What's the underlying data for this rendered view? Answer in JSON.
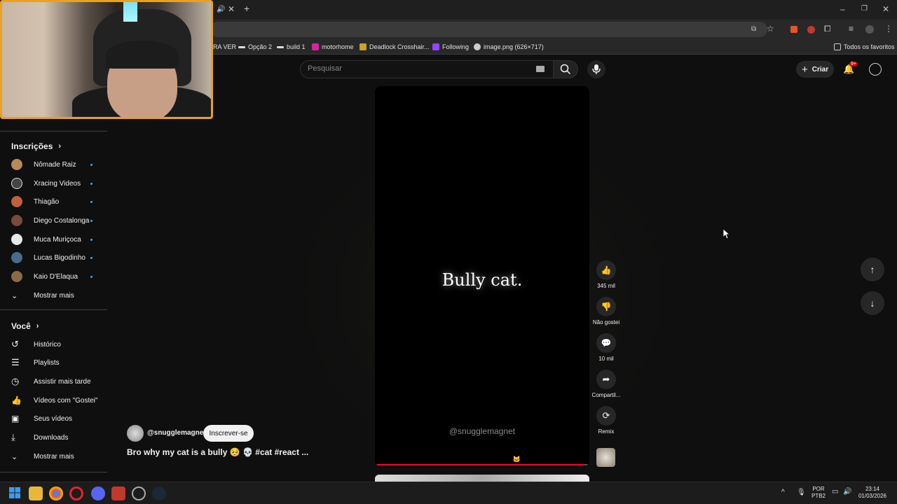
{
  "browser": {
    "new_tab_label": "+",
    "bookmarks": [
      {
        "label": "RA VER",
        "color": "#333333"
      },
      {
        "label": "Opção 2",
        "color": "#dddddd"
      },
      {
        "label": "build 1",
        "color": "#dddddd"
      },
      {
        "label": "motorhome",
        "color": "#d6249f"
      },
      {
        "label": "Deadlock Crosshair...",
        "color": "#c9a227"
      },
      {
        "label": "Following",
        "color": "#9146ff"
      },
      {
        "label": "image.png (626×717)",
        "color": "#cccccc"
      }
    ],
    "all_bookmarks_label": "Todos os favoritos"
  },
  "header": {
    "search_placeholder": "Pesquisar",
    "create_label": "Criar",
    "notifications_badge": "9+"
  },
  "sidebar": {
    "subscriptions_title": "Inscrições",
    "subscriptions": [
      {
        "name": "Nômade Raiz",
        "color": "#b88a5a"
      },
      {
        "name": "Xracing Videos",
        "color": "#444444"
      },
      {
        "name": "Thiagão",
        "color": "#c0603a"
      },
      {
        "name": "Diego Costalonga",
        "color": "#7a4a3a"
      },
      {
        "name": "Muca Muriçoca",
        "color": "#e8e8e8"
      },
      {
        "name": "Lucas Bigodinho",
        "color": "#4a6a8a"
      },
      {
        "name": "Kaio D'Elaqua",
        "color": "#8a6a4a"
      }
    ],
    "show_more_label": "Mostrar mais",
    "you_title": "Você",
    "you_items": [
      {
        "label": "Histórico",
        "icon": "history-icon"
      },
      {
        "label": "Playlists",
        "icon": "playlists-icon"
      },
      {
        "label": "Assistir mais tarde",
        "icon": "watch-later-icon"
      },
      {
        "label": "Vídeos com \"Gostei\"",
        "icon": "liked-icon"
      },
      {
        "label": "Seus vídeos",
        "icon": "your-videos-icon"
      },
      {
        "label": "Downloads",
        "icon": "downloads-icon"
      },
      {
        "label": "Mostrar mais",
        "icon": "chevron-down-icon"
      }
    ]
  },
  "short": {
    "caption": "Bully cat.",
    "watermark": "@snugglemagnet",
    "progress": 0.97,
    "channel": "@snugglemagnet",
    "subscribe_label": "Inscrever-se",
    "title": "Bro why my cat is a bully 🥺 💀 #cat #react ...",
    "likes": "345 mil",
    "dislike_label": "Não gostei",
    "comments": "10 mil",
    "share_label": "Compartil...",
    "remix_label": "Remix"
  },
  "taskbar": {
    "lang": "POR",
    "layout": "PTB2",
    "time": "23:14",
    "date": "01/03/2026"
  }
}
